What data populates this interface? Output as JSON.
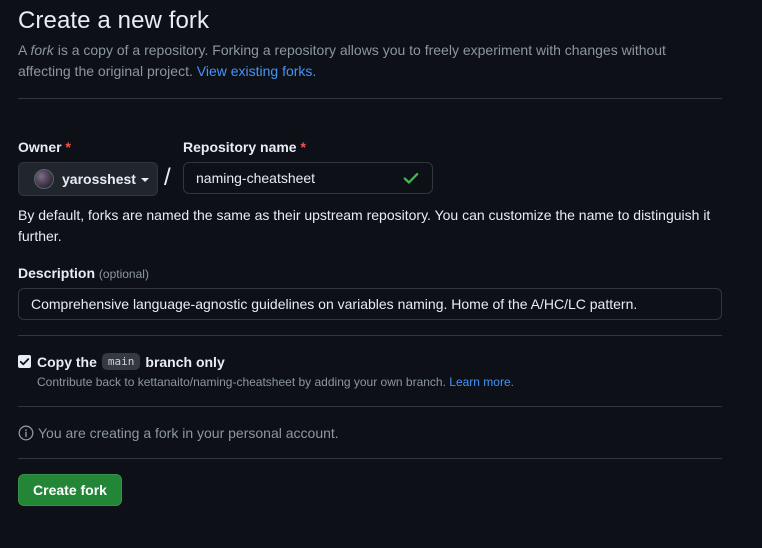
{
  "header": {
    "title": "Create a new fork",
    "subtitle_prefix": "A ",
    "subtitle_em": "fork",
    "subtitle_rest": " is a copy of a repository. Forking a repository allows you to freely experiment with changes without affecting the original project. ",
    "view_forks_link": "View existing forks."
  },
  "owner": {
    "label": "Owner",
    "required_mark": "*",
    "selected": "yarosshest"
  },
  "separator": "/",
  "repo": {
    "label": "Repository name",
    "required_mark": "*",
    "value": "naming-cheatsheet",
    "valid": true
  },
  "helper_text": "By default, forks are named the same as their upstream repository. You can customize the name to distinguish it further.",
  "description": {
    "label": "Description",
    "optional": "(optional)",
    "value": "Comprehensive language-agnostic guidelines on variables naming. Home of the A/HC/LC pattern."
  },
  "copy_branch": {
    "checked": true,
    "label_before": "Copy the",
    "branch": "main",
    "label_after": "branch only",
    "note": "Contribute back to kettanaito/naming-cheatsheet by adding your own branch.",
    "learn_more": "Learn more."
  },
  "info": {
    "icon": "info-icon",
    "text": "You are creating a fork in your personal account."
  },
  "actions": {
    "create_label": "Create fork"
  },
  "colors": {
    "background": "#0d1117",
    "link": "#4493f8",
    "primary_button": "#238636",
    "required": "#f85149",
    "success_check": "#3fb950"
  }
}
